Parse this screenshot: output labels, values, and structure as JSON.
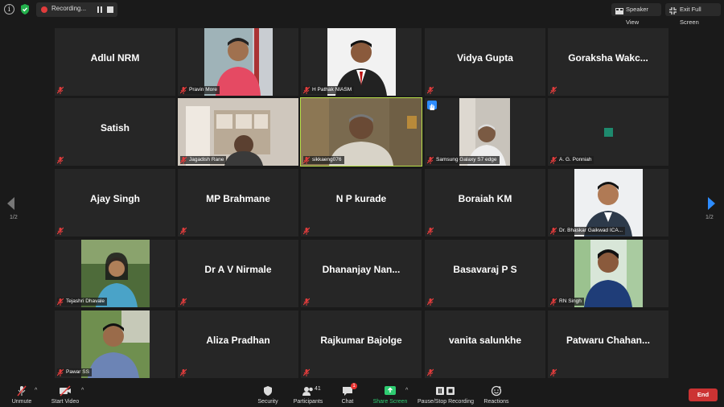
{
  "topbar": {
    "recording_label": "Recording...",
    "speaker_view_label": "Speaker View",
    "exit_fullscreen_label": "Exit Full Screen"
  },
  "tiles": [
    {
      "name": "Adlul NRM"
    },
    {
      "label": "Pravin More"
    },
    {
      "label": "H Pathak NIASM"
    },
    {
      "name": "Vidya Gupta"
    },
    {
      "name": "Goraksha  Wakc..."
    },
    {
      "name": "Satish"
    },
    {
      "label": "Jagadish Rane"
    },
    {
      "label": "sikkaeng076"
    },
    {
      "label": "Samsung Galaxy S7 edge"
    },
    {
      "label": "A. G. Ponniah"
    },
    {
      "name": "Ajay Singh"
    },
    {
      "name": "MP Brahmane"
    },
    {
      "name": "N P kurade"
    },
    {
      "name": "Boraiah KM"
    },
    {
      "label": "Dr. Bhaskar Gaikwad ICA..."
    },
    {
      "label": "Tejashri Dhavale"
    },
    {
      "name": "Dr A V Nirmale"
    },
    {
      "name": "Dhananjay  Nan..."
    },
    {
      "name": "Basavaraj P S"
    },
    {
      "label": "RN Singh"
    },
    {
      "label": "Pawar SS"
    },
    {
      "name": "Aliza Pradhan"
    },
    {
      "name": "Rajkumar Bajolge"
    },
    {
      "name": "vanita salunkhe"
    },
    {
      "name": "Patwaru  Chahan..."
    }
  ],
  "pagination": {
    "left": "1/2",
    "right": "1/2"
  },
  "toolbar": {
    "unmute": "Unmute",
    "start_video": "Start Video",
    "security": "Security",
    "participants": "Participants",
    "participants_count": "41",
    "chat": "Chat",
    "chat_badge": "1",
    "share_screen": "Share Screen",
    "pause_stop_recording": "Pause/Stop Recording",
    "reactions": "Reactions",
    "end": "End"
  },
  "colors": {
    "active_speaker": "#b8e04a",
    "share_screen": "#2ecc71",
    "end_button": "#cc3333",
    "nav_next": "#2d8cff"
  }
}
